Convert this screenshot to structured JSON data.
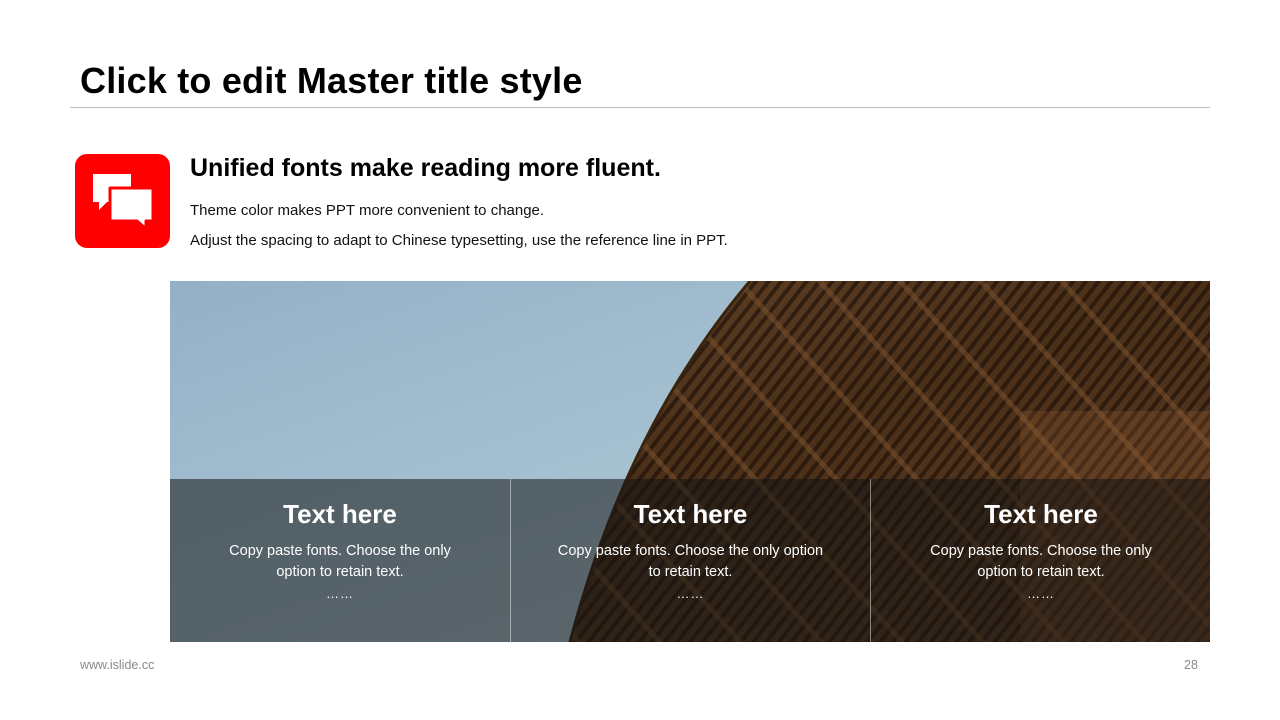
{
  "slide": {
    "title": "Click to edit Master title style"
  },
  "intro": {
    "icon": "chat-bubbles-icon",
    "icon_color": "#ff0000",
    "headline": "Unified fonts make reading more fluent.",
    "line1": "Theme color makes PPT more convenient to change.",
    "line2": "Adjust the spacing to adapt to Chinese typesetting, use the reference line in PPT."
  },
  "panels": [
    {
      "title": "Text here",
      "text": "Copy paste fonts. Choose the only option to retain text.",
      "dots": "……"
    },
    {
      "title": "Text here",
      "text": "Copy paste fonts. Choose the only option to retain text.",
      "dots": "……"
    },
    {
      "title": "Text here",
      "text": "Copy paste fonts. Choose the only option to retain text.",
      "dots": "……"
    }
  ],
  "footer": {
    "url": "www.islide.cc",
    "page": "28"
  }
}
